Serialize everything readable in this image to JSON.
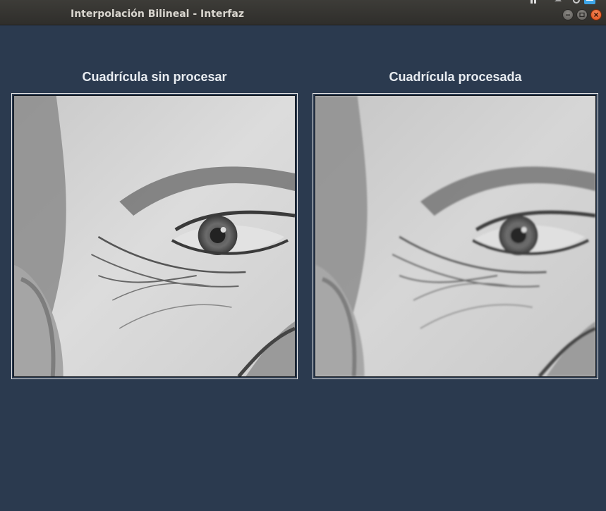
{
  "window": {
    "title": "Interpolación Bilineal - Interfaz"
  },
  "panels": [
    {
      "title": "Cuadrícula sin procesar"
    },
    {
      "title": "Cuadrícula procesada"
    }
  ]
}
